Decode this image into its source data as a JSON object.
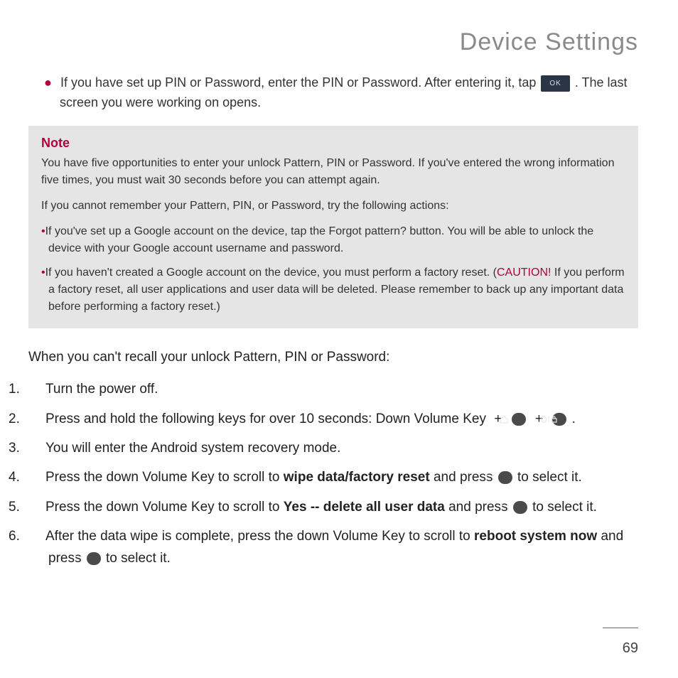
{
  "title": "Device Settings",
  "intro": {
    "pre": "If you have set up PIN or Password, enter the PIN or Password. After entering it, tap ",
    "ok": "OK",
    "post": ". The last screen you were working on opens."
  },
  "note": {
    "heading": "Note",
    "p1": "You have five opportunities to enter your unlock Pattern, PIN or Password. If you've entered the wrong information five times, you must wait 30 seconds before you can attempt again.",
    "p2": "If you cannot remember your Pattern, PIN, or Password, try the following actions:",
    "b1": "If you've set up a Google account on the device, tap the Forgot pattern? button. You will be able to unlock the device with your Google account username and password.",
    "b2_pre": "If you haven't created a Google account on the device, you must perform a factory reset. (",
    "b2_caution": "CAUTION!",
    "b2_post": " If you perform a factory reset, all user applications and user data will be deleted. Please remember to back up any important data before performing a factory reset.)"
  },
  "body_lead": "When you can't recall your unlock Pattern, PIN or Password:",
  "steps": {
    "s1": "Turn the power off.",
    "s2_pre": "Press and hold the following keys for over 10 seconds: Down Volume Key",
    "s2_post": ".",
    "s3": "You will enter the Android system recovery mode.",
    "s4_pre": "Press the down Volume Key to scroll to ",
    "s4_bold": "wipe data/factory reset",
    "s4_mid": " and press ",
    "s4_post": " to select it.",
    "s5_pre": "Press the down Volume Key to scroll to ",
    "s5_bold": "Yes -- delete all user data",
    "s5_mid": " and press ",
    "s5_post": " to select it.",
    "s6_pre": "After the data wipe is complete, press the down Volume Key to scroll to ",
    "s6_bold": "reboot system now",
    "s6_mid": " and press ",
    "s6_post": " to select it."
  },
  "page_number": "69",
  "glyphs": {
    "plus": "+"
  }
}
